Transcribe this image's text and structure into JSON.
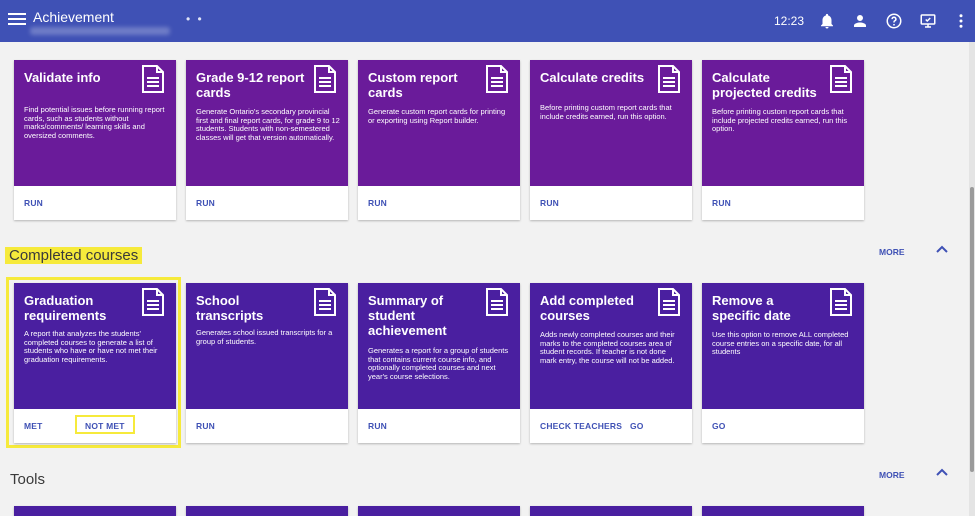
{
  "app": {
    "title": "Achievement",
    "title_suffix": "• •",
    "time": "12:23"
  },
  "colors": {
    "topbar": "#3f51b5",
    "card_purple": "#6a1b9a",
    "card_indigo": "#4a1fa0",
    "action_text": "#3f51b5",
    "highlight": "#f6ea3b"
  },
  "icons": {
    "menu": "hamburger-menu-icon",
    "notifications": "bell-icon",
    "account": "person-icon",
    "help": "help-circle-icon",
    "screen": "monitor-icon",
    "more": "more-vert-icon",
    "card": "document-icon",
    "collapse": "chevron-up-icon"
  },
  "report_cards": [
    {
      "title": "Validate info",
      "desc": "Find potential issues before running report cards, such as students without marks/comments/ learning skills and oversized comments.",
      "actions": [
        "RUN"
      ]
    },
    {
      "title": "Grade 9-12 report cards",
      "desc": "Generate Ontario's secondary provincial first and final report cards, for grade 9 to 12 students. Students with non-semestered classes will get that version automatically.",
      "actions": [
        "RUN"
      ]
    },
    {
      "title": "Custom report cards",
      "desc": "Generate custom report cards for printing or exporting using Report builder.",
      "actions": [
        "RUN"
      ]
    },
    {
      "title": "Calculate credits",
      "desc": "Before printing custom report cards that include credits earned, run this option.",
      "actions": [
        "RUN"
      ]
    },
    {
      "title": "Calculate projected credits",
      "desc": "Before printing custom report cards that include projected credits earned, run this option.",
      "actions": [
        "RUN"
      ]
    }
  ],
  "completed_courses": {
    "title": "Completed courses",
    "more_label": "MORE",
    "cards": [
      {
        "title": "Graduation requirements",
        "desc": "A report that analyzes the students' completed courses to generate a list of students who have or have not met their graduation requirements.",
        "actions": [
          "MET",
          "NOT MET"
        ]
      },
      {
        "title": "School transcripts",
        "desc": "Generates school issued transcripts for a group of students.",
        "actions": [
          "RUN"
        ]
      },
      {
        "title": "Summary of student achievement",
        "desc": "Generates a report for a group of students that contains current course info, and optionally completed courses and next year's course selections.",
        "actions": [
          "RUN"
        ]
      },
      {
        "title": "Add completed courses",
        "desc": "Adds newly completed courses and their marks to the completed courses area of student records. If teacher is not done mark entry, the course will not be added.",
        "actions": [
          "CHECK TEACHERS",
          "GO"
        ]
      },
      {
        "title": "Remove a specific date",
        "desc": "Use this option to remove ALL completed course entries on a specific date, for all students",
        "actions": [
          "GO"
        ]
      }
    ]
  },
  "tools": {
    "title": "Tools",
    "more_label": "MORE"
  }
}
